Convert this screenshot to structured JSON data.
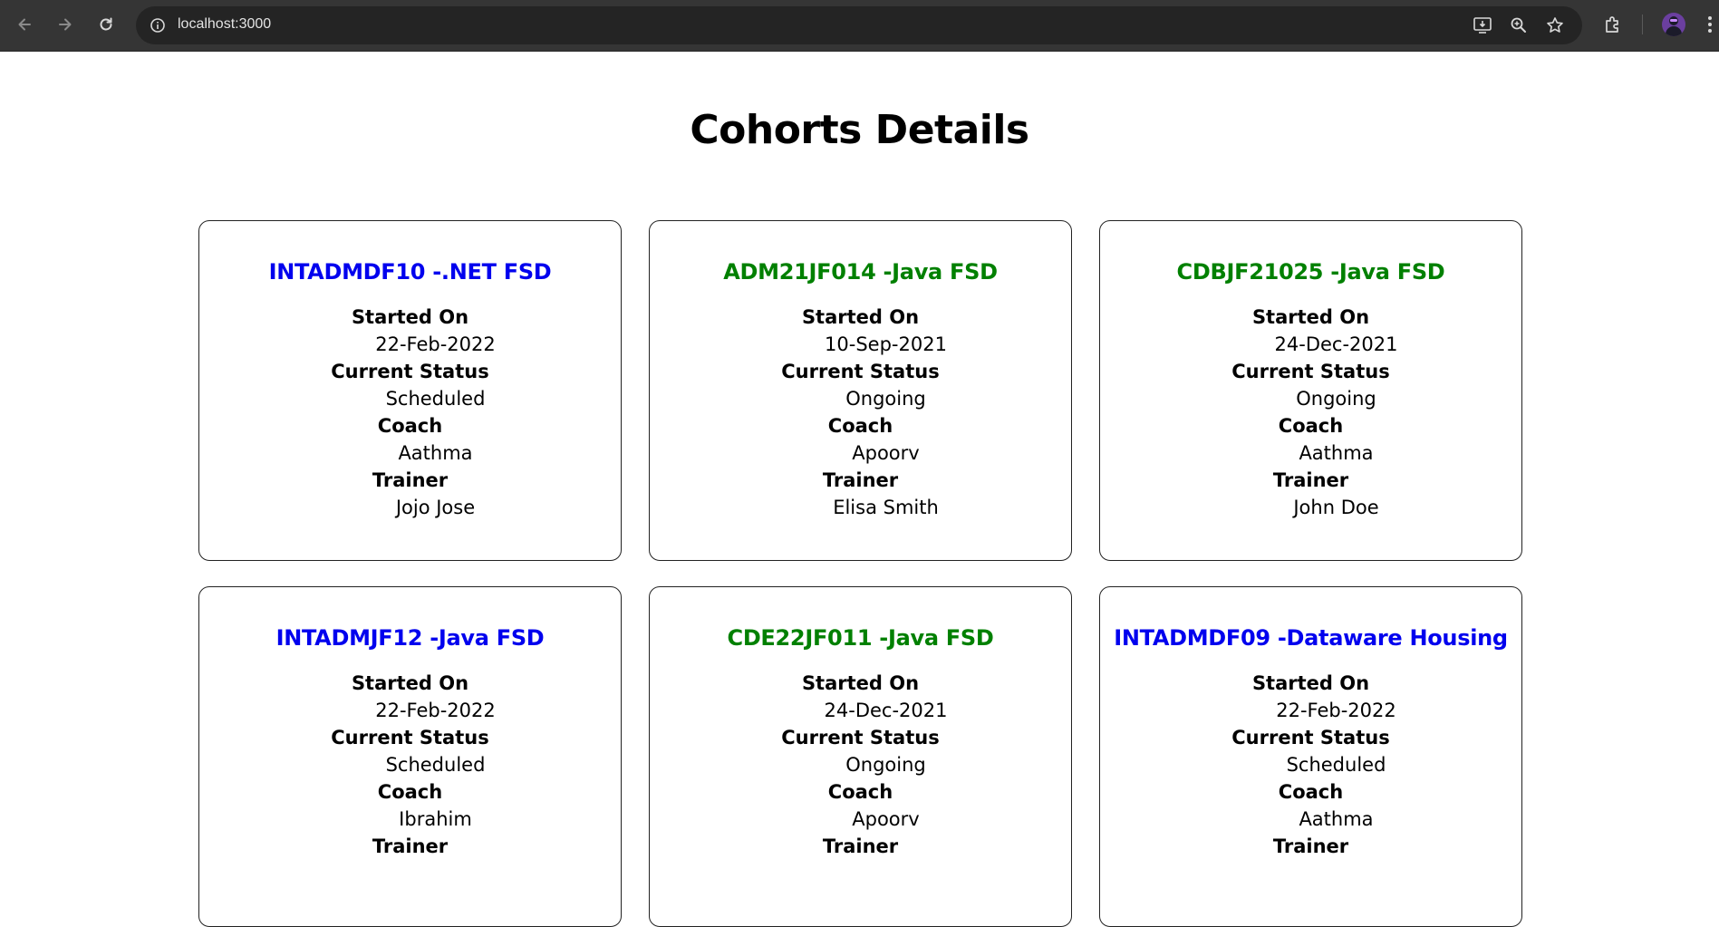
{
  "browser": {
    "url": "localhost:3000"
  },
  "page": {
    "title": "Cohorts Details"
  },
  "labels": {
    "started_on": "Started On",
    "current_status": "Current Status",
    "coach": "Coach",
    "trainer": "Trainer"
  },
  "colors": {
    "scheduled": "#0000ee",
    "ongoing": "#008000"
  },
  "cohorts": [
    {
      "title": "INTADMDF10 -.NET FSD",
      "started_on": "22-Feb-2022",
      "status": "Scheduled",
      "coach": "Aathma",
      "trainer": "Jojo Jose"
    },
    {
      "title": "ADM21JF014 -Java FSD",
      "started_on": "10-Sep-2021",
      "status": "Ongoing",
      "coach": "Apoorv",
      "trainer": "Elisa Smith"
    },
    {
      "title": "CDBJF21025 -Java FSD",
      "started_on": "24-Dec-2021",
      "status": "Ongoing",
      "coach": "Aathma",
      "trainer": "John Doe"
    },
    {
      "title": "INTADMJF12 -Java FSD",
      "started_on": "22-Feb-2022",
      "status": "Scheduled",
      "coach": "Ibrahim"
    },
    {
      "title": "CDE22JF011 -Java FSD",
      "started_on": "24-Dec-2021",
      "status": "Ongoing",
      "coach": "Apoorv"
    },
    {
      "title": "INTADMDF09 -Dataware Housing",
      "started_on": "22-Feb-2022",
      "status": "Scheduled",
      "coach": "Aathma"
    }
  ]
}
